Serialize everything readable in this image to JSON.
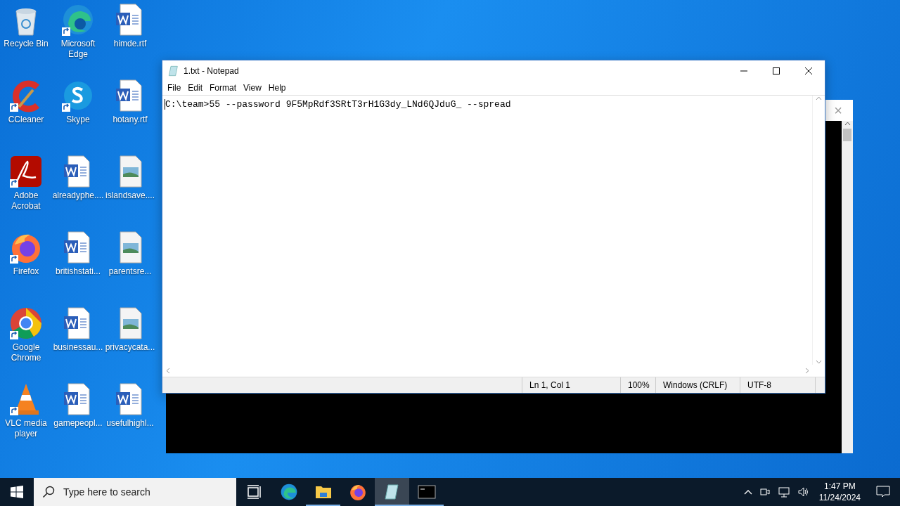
{
  "desktop_icons": [
    {
      "label": "Recycle Bin",
      "kind": "recycle",
      "shortcut": false
    },
    {
      "label": "CCleaner",
      "kind": "ccleaner",
      "shortcut": true
    },
    {
      "label": "Adobe Acrobat",
      "kind": "acrobat",
      "shortcut": true
    },
    {
      "label": "Firefox",
      "kind": "firefox",
      "shortcut": true
    },
    {
      "label": "Google Chrome",
      "kind": "chrome",
      "shortcut": true
    },
    {
      "label": "VLC media player",
      "kind": "vlc",
      "shortcut": true
    },
    {
      "label": "Microsoft Edge",
      "kind": "edge",
      "shortcut": true
    },
    {
      "label": "Skype",
      "kind": "skype",
      "shortcut": true
    },
    {
      "label": "alreadyphe....",
      "kind": "word",
      "shortcut": false
    },
    {
      "label": "britishstati...",
      "kind": "word",
      "shortcut": false
    },
    {
      "label": "businessau...",
      "kind": "word",
      "shortcut": false
    },
    {
      "label": "gamepeopl...",
      "kind": "word",
      "shortcut": false
    },
    {
      "label": "himde.rtf",
      "kind": "word",
      "shortcut": false
    },
    {
      "label": "hotany.rtf",
      "kind": "word",
      "shortcut": false
    },
    {
      "label": "islandsave....",
      "kind": "image",
      "shortcut": false
    },
    {
      "label": "parentsre...",
      "kind": "image",
      "shortcut": false
    },
    {
      "label": "privacycata...",
      "kind": "image",
      "shortcut": false
    },
    {
      "label": "usefulhighl...",
      "kind": "word",
      "shortcut": false
    }
  ],
  "console": {
    "close": "×"
  },
  "notepad": {
    "title": "1.txt - Notepad",
    "menu": [
      "File",
      "Edit",
      "Format",
      "View",
      "Help"
    ],
    "text": "C:\\team>55 --password 9F5MpRdf3SRtT3rH1G3dy_LNd6QJduG_ --spread",
    "status": [
      "Ln 1, Col 1",
      "100%",
      "Windows (CRLF)",
      "UTF-8"
    ]
  },
  "taskbar": {
    "search": {
      "placeholder": "Type here to search"
    },
    "apps": [
      {
        "kind": "taskview",
        "open": false,
        "selected": false
      },
      {
        "kind": "edge",
        "open": false,
        "selected": false
      },
      {
        "kind": "explorer",
        "open": true,
        "selected": false
      },
      {
        "kind": "firefox",
        "open": false,
        "selected": false
      },
      {
        "kind": "notepad",
        "open": true,
        "selected": true
      },
      {
        "kind": "terminal",
        "open": true,
        "selected": false
      }
    ],
    "time": "1:47 PM",
    "date": "11/24/2024"
  }
}
